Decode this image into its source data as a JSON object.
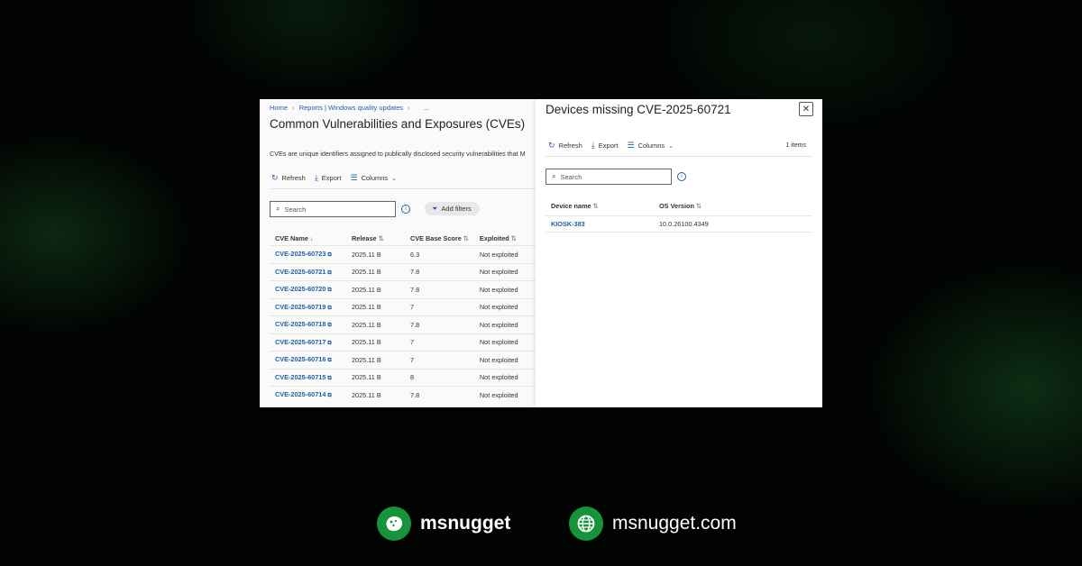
{
  "left": {
    "breadcrumb": [
      "Home",
      "Reports | Windows quality updates"
    ],
    "more": "...",
    "title": "Common Vulnerabilities and Exposures (CVEs)",
    "description": "CVEs are unique identifiers assigned to publically disclosed security vulnerabilities that M",
    "toolbar": {
      "refresh": "Refresh",
      "export": "Export",
      "columns": "Columns"
    },
    "search_placeholder": "Search",
    "add_filters": "Add filters",
    "columns": [
      "CVE Name",
      "Release",
      "CVE Base Score",
      "Exploited"
    ],
    "rows": [
      {
        "cve": "CVE-2025-60723",
        "release": "2025.11 B",
        "score": "6.3",
        "exploited": "Not exploited"
      },
      {
        "cve": "CVE-2025-60721",
        "release": "2025.11 B",
        "score": "7.8",
        "exploited": "Not exploited"
      },
      {
        "cve": "CVE-2025-60720",
        "release": "2025.11 B",
        "score": "7.8",
        "exploited": "Not exploited"
      },
      {
        "cve": "CVE-2025-60719",
        "release": "2025.11 B",
        "score": "7",
        "exploited": "Not exploited"
      },
      {
        "cve": "CVE-2025-60718",
        "release": "2025.11 B",
        "score": "7.8",
        "exploited": "Not exploited"
      },
      {
        "cve": "CVE-2025-60717",
        "release": "2025.11 B",
        "score": "7",
        "exploited": "Not exploited"
      },
      {
        "cve": "CVE-2025-60716",
        "release": "2025.11 B",
        "score": "7",
        "exploited": "Not exploited"
      },
      {
        "cve": "CVE-2025-60715",
        "release": "2025.11 B",
        "score": "8",
        "exploited": "Not exploited"
      },
      {
        "cve": "CVE-2025-60714",
        "release": "2025.11 B",
        "score": "7.8",
        "exploited": "Not exploited"
      }
    ]
  },
  "panel": {
    "title": "Devices missing CVE-2025-60721",
    "toolbar": {
      "refresh": "Refresh",
      "export": "Export",
      "columns": "Columns"
    },
    "count": "1 items",
    "search_placeholder": "Search",
    "columns": [
      "Device name",
      "OS Version"
    ],
    "rows": [
      {
        "device": "KIOSK-383",
        "os": "10.0.26100.4349"
      }
    ]
  },
  "footer": {
    "brand_name": "msnugget",
    "site": "msnugget.com",
    "accent": "#17933a"
  },
  "icons": [
    "refresh-icon",
    "export-icon",
    "columns-icon",
    "search-icon",
    "info-icon",
    "filter-icon",
    "close-icon",
    "external-link-icon",
    "nugget-icon",
    "globe-icon"
  ]
}
